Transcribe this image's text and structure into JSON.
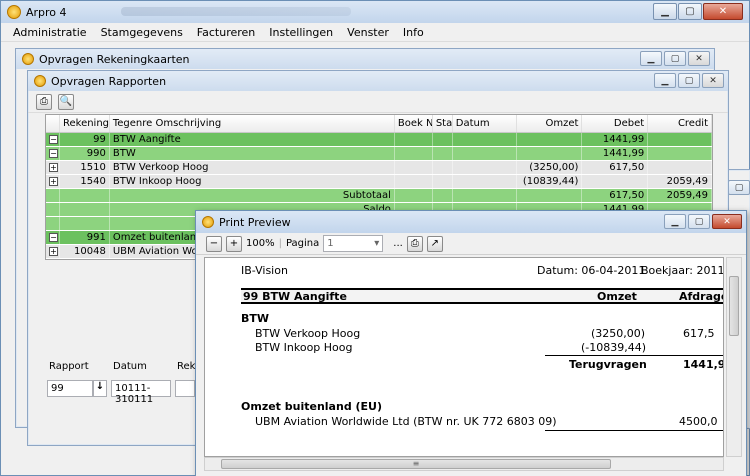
{
  "app": {
    "title": "Arpro 4",
    "menu": [
      "Administratie",
      "Stamgegevens",
      "Factureren",
      "Instellingen",
      "Venster",
      "Info"
    ]
  },
  "window_back": {
    "title": "Opvragen Rekeningkaarten"
  },
  "window_rapporten": {
    "title": "Opvragen Rapporten",
    "columns": [
      "Rekening",
      "Tegenre Omschrijving",
      "Boek Nr",
      "Stat",
      "Datum",
      "Omzet",
      "Debet",
      "Credit"
    ],
    "rows": [
      {
        "exp": "−",
        "rek": "99",
        "oms": "BTW Aangifte",
        "omzet": "",
        "debet": "1441,99",
        "credit": "",
        "style": "g1"
      },
      {
        "exp": "−",
        "rek": "990",
        "oms": "BTW",
        "omzet": "",
        "debet": "1441,99",
        "credit": "",
        "style": "g2"
      },
      {
        "exp": "+",
        "rek": "1510",
        "oms": "BTW Verkoop Hoog",
        "omzet": "(3250,00)",
        "debet": "617,50",
        "credit": "",
        "style": "g3"
      },
      {
        "exp": "+",
        "rek": "1540",
        "oms": "BTW Inkoop Hoog",
        "omzet": "(10839,44)",
        "debet": "",
        "credit": "2059,49",
        "style": "g3"
      },
      {
        "exp": "",
        "rek": "",
        "oms": "Subtotaal",
        "omzet": "",
        "debet": "617,50",
        "credit": "2059,49",
        "style": "g2"
      },
      {
        "exp": "",
        "rek": "",
        "oms": "Saldo",
        "omzet": "",
        "debet": "1441,99",
        "credit": "",
        "style": "g2"
      },
      {
        "exp": "",
        "rek": "",
        "oms": "",
        "omzet": "",
        "debet": "",
        "credit": "",
        "style": "g2"
      },
      {
        "exp": "−",
        "rek": "991",
        "oms": "Omzet buitenland (EU)",
        "omzet": "",
        "debet": "",
        "credit": "",
        "style": "g1"
      },
      {
        "exp": "+",
        "rek": "10048",
        "oms": "UBM Aviation Worldwide",
        "omzet": "",
        "debet": "",
        "credit": "",
        "style": "g3"
      }
    ],
    "filters": {
      "rapport_label": "Rapport",
      "rapport_value": "99",
      "datum_label": "Datum",
      "datum_value": "10111-310111",
      "rek_label": "Rek"
    }
  },
  "print_preview": {
    "title": "Print Preview",
    "zoom": "100%",
    "page_label": "Pagina",
    "page_value": "1",
    "ellipsis": "...",
    "doc": {
      "company": "IB-Vision",
      "datum": "Datum: 06-04-2011",
      "boekjaar": "Boekjaar: 2011",
      "header_title": "99 BTW Aangifte",
      "header_omzet": "Omzet",
      "header_afdragen": "Afdragen",
      "section1": "BTW",
      "line1_label": "BTW Verkoop Hoog",
      "line1_omzet": "(3250,00)",
      "line1_amount": "617,5",
      "line2_label": "BTW Inkoop Hoog",
      "line2_omzet": "(-10839,44)",
      "terugvragen_label": "Terugvragen",
      "terugvragen_amount": "1441,9",
      "section2": "Omzet buitenland (EU)",
      "line3_label": "UBM Aviation Worldwide Ltd (BTW nr. UK 772 6803 09)",
      "line3_amount": "4500,0"
    }
  }
}
